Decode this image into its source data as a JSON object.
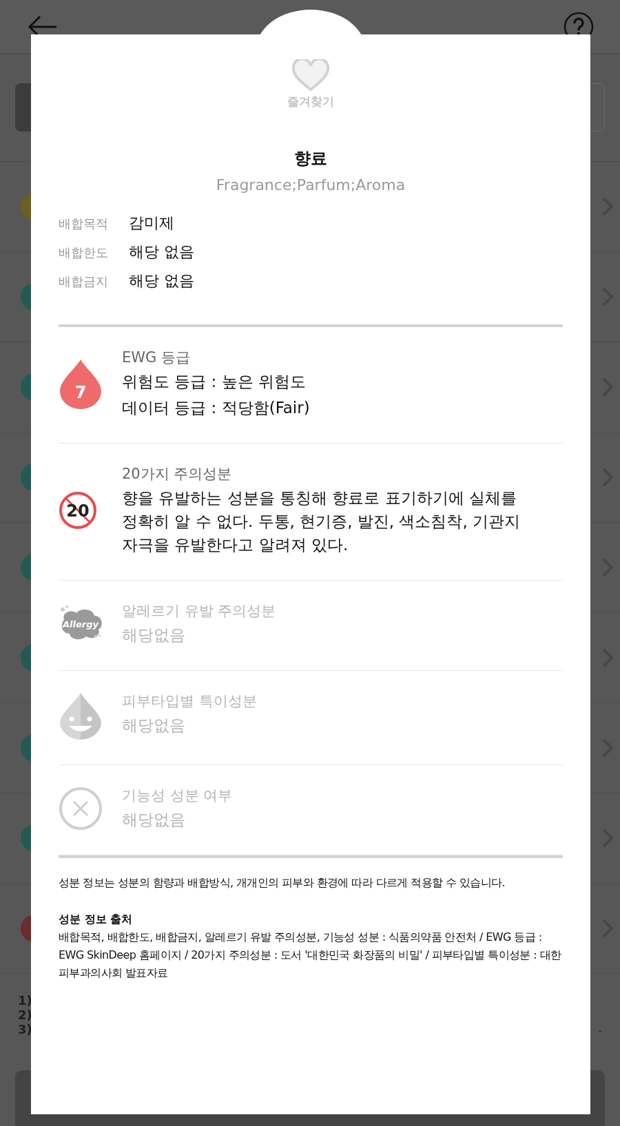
{
  "background": {
    "notes": [
      "1)",
      "2)",
      "3)"
    ],
    "trailing_mark": ".",
    "rows": [
      {
        "color": "#6b5f22"
      },
      {
        "color": "#235a52"
      },
      {
        "color": "#235a52"
      },
      {
        "color": "#235a52"
      },
      {
        "color": "#235a52"
      },
      {
        "color": "#235a52"
      },
      {
        "color": "#235a52"
      },
      {
        "color": "#235a52"
      },
      {
        "color": "#6a2c2c"
      }
    ]
  },
  "modal": {
    "favorite": {
      "label": "즐겨찾기",
      "selected": false
    },
    "name": "향료",
    "inci": "Fragrance;Parfum;Aroma",
    "properties": [
      {
        "label": "배합목적",
        "value": "감미제"
      },
      {
        "label": "배합한도",
        "value": "해당 없음"
      },
      {
        "label": "배합금지",
        "value": "해당 없음"
      }
    ],
    "sections": [
      {
        "kind": "ewg",
        "disabled": false,
        "icon_text": "7",
        "title": "EWG 등급",
        "lines": [
          "위험도 등급 : 높은 위험도",
          "데이터 등급 : 적당함(Fair)"
        ]
      },
      {
        "kind": "caution20",
        "disabled": false,
        "icon_text": "20",
        "title": "20가지 주의성분",
        "lines": [
          "향을 유발하는 성분을 통칭해 향료로 표기하기에 실체를 정확히 알 수 없다. 두통, 현기증, 발진, 색소침착, 기관지 자극을 유발한다고 알려져 있다."
        ]
      },
      {
        "kind": "allergy",
        "disabled": true,
        "icon_text": "Allergy",
        "title": "알레르기 유발 주의성분",
        "lines": [
          "해당없음"
        ]
      },
      {
        "kind": "skintype",
        "disabled": true,
        "title": "피부타입별 특이성분",
        "lines": [
          "해당없음"
        ]
      },
      {
        "kind": "functional",
        "disabled": true,
        "title": "기능성 성분 여부",
        "lines": [
          "해당없음"
        ]
      }
    ],
    "disclaimer": "성분 정보는 성분의 함량과 배합방식, 개개인의 피부와 환경에 따라 다르게 적용할 수 있습니다.",
    "source": {
      "title": "성분 정보 출처",
      "text": "배합목적, 배합한도, 배합금지, 알레르기 유발 주의성분, 기능성 성분 : 식품의약품 안전처 / EWG 등급 : EWG SkinDeep 홈페이지 / 20가지 주의성분 : 도서 '대한민국 화장품의 비밀' / 피부타입별 특이성분 : 대한피부과의사회 발표자료"
    }
  }
}
